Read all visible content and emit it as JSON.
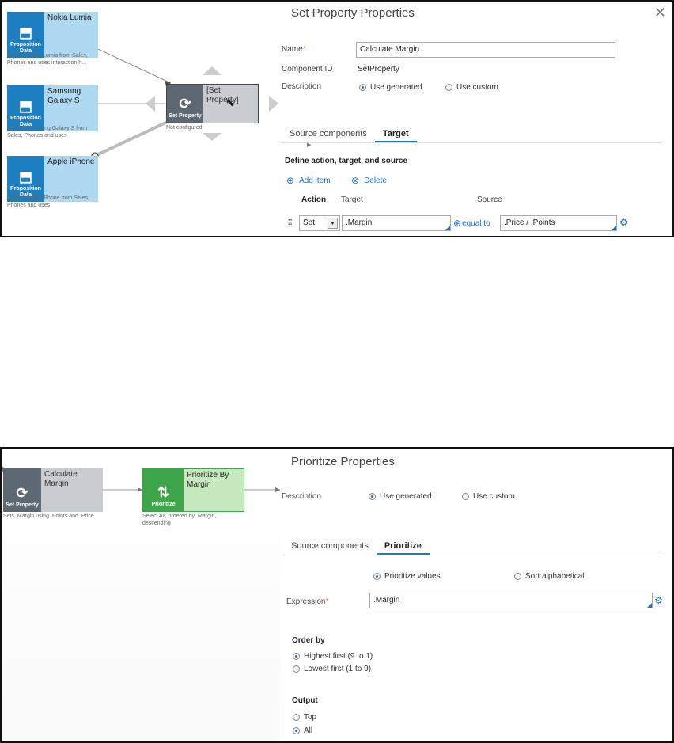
{
  "top": {
    "nodes": [
      {
        "title": "Nokia Lumia",
        "icon_label": "Proposition Data",
        "icon": "proposition-data-icon",
        "desc": "Imports Nokia Lumia from Sales, Phones and uses interaction h..."
      },
      {
        "title": "Samsung Galaxy S",
        "icon_label": "Proposition Data",
        "icon": "proposition-data-icon",
        "desc": "Imports Samsung Galaxy S from Sales, Phones and uses"
      },
      {
        "title": "Apple iPhone",
        "icon_label": "Proposition Data",
        "icon": "proposition-data-icon",
        "desc": "Imports Apple iPhone from Sales, Phones and uses"
      }
    ],
    "set_node": {
      "title": "[Set Property]",
      "icon_label": "Set Property",
      "icon": "set-property-icon",
      "status": "Not configured"
    },
    "props": {
      "title": "Set Property Properties",
      "name_label": "Name",
      "name_value": "Calculate Margin",
      "component_id_label": "Component ID",
      "component_id_value": "SetProperty",
      "description_label": "Description",
      "radio_generated": "Use generated",
      "radio_custom": "Use custom",
      "tab_source": "Source components",
      "tab_target": "Target",
      "section_title": "Define action, target, and source",
      "add_item": "Add item",
      "delete": "Delete",
      "col_action": "Action",
      "col_target": "Target",
      "col_source": "Source",
      "row": {
        "action": "Set",
        "target": ".Margin",
        "operator": "equal to",
        "source": ".Price / .Points"
      }
    }
  },
  "bottom": {
    "set_node": {
      "title": "Calculate Margin",
      "icon_label": "Set Property",
      "desc": "Sets .Margin using .Points and .Price"
    },
    "prio_node": {
      "title": "Prioritize By Margin",
      "icon_label": "Prioritize",
      "desc": "Select All, ordered by .Margin, descending"
    },
    "props": {
      "title": "Prioritize Properties",
      "description_label": "Description",
      "radio_generated": "Use generated",
      "radio_custom": "Use custom",
      "tab_source": "Source components",
      "tab_prioritize": "Prioritize",
      "radio_prioritize": "Prioritize values",
      "radio_sort": "Sort alphabetical",
      "expression_label": "Expression",
      "expression_value": ".Margin",
      "order_by_label": "Order by",
      "order_highest": "Highest first (9 to 1)",
      "order_lowest": "Lowest first (1 to 9)",
      "output_label": "Output",
      "output_top": "Top",
      "output_all": "All"
    }
  },
  "colors": {
    "proposition": "#1e7fc0",
    "set_property": "#5e6873",
    "prioritize": "#3da54a",
    "accent": "#1e6fcc"
  }
}
